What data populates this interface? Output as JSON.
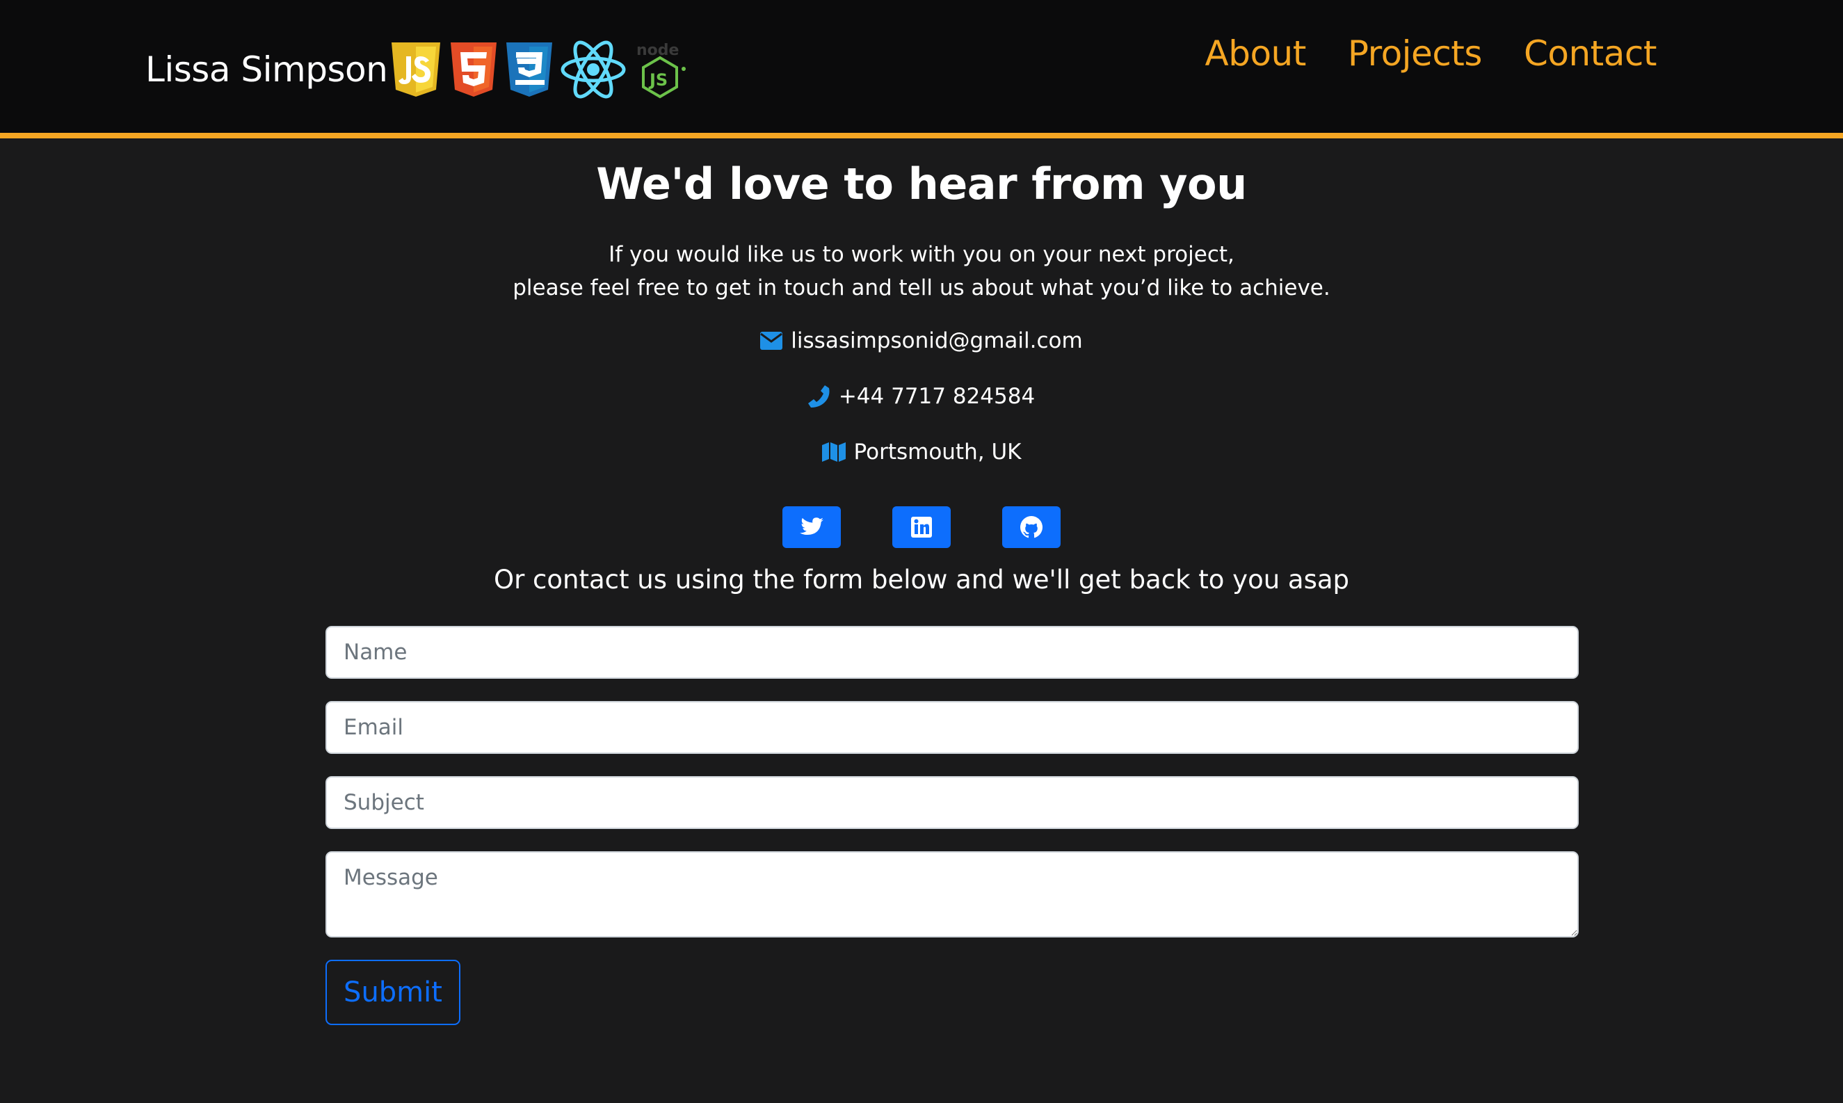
{
  "header": {
    "brand_name": "Lissa Simpson",
    "tech_icons": [
      "javascript-icon",
      "html5-icon",
      "css3-icon",
      "react-icon",
      "nodejs-icon"
    ],
    "nav": [
      {
        "label": "About"
      },
      {
        "label": "Projects"
      },
      {
        "label": "Contact"
      }
    ],
    "accent_color": "#f5a623"
  },
  "main": {
    "heading": "We'd love to hear from you",
    "intro_line1": "If you would like us to work with you on your next project,",
    "intro_line2": "please feel free to get in touch and tell us about what you’d like to achieve.",
    "email": "lissasimpsonid@gmail.com",
    "phone": "+44 7717 824584",
    "location": "Portsmouth, UK",
    "contact_icons": [
      "envelope-icon",
      "phone-icon",
      "map-icon"
    ],
    "socials": [
      "twitter-icon",
      "linkedin-icon",
      "github-icon"
    ],
    "form_intro": "Or contact us using the form below and we'll get back to you asap"
  },
  "form": {
    "name_placeholder": "Name",
    "email_placeholder": "Email",
    "subject_placeholder": "Subject",
    "message_placeholder": "Message",
    "submit_label": "Submit",
    "button_color": "#0d6efd"
  }
}
